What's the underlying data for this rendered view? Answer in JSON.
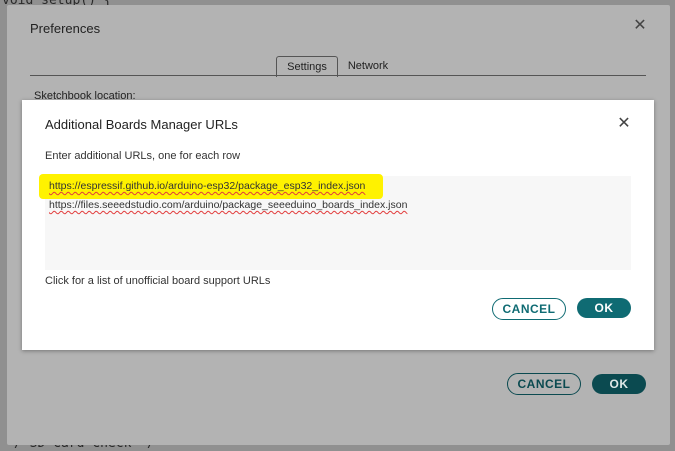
{
  "background_code": {
    "line_top": "void setup() {",
    "line_bottom": "/ SD Card Check */"
  },
  "preferences": {
    "title": "Preferences",
    "tabs": [
      {
        "label": "Settings",
        "active": true
      },
      {
        "label": "Network",
        "active": false
      }
    ],
    "sketchbook_label": "Sketchbook location:",
    "cancel_label": "CANCEL",
    "ok_label": "OK"
  },
  "boards_dialog": {
    "title": "Additional Boards Manager URLs",
    "instruction": "Enter additional URLs, one for each row",
    "urls": [
      "https://espressif.github.io/arduino-esp32/package_esp32_index.json",
      "https://files.seeedstudio.com/arduino/package_seeeduino_boards_index.json"
    ],
    "highlighted_url_index": 0,
    "unofficial_link": "Click for a list of unofficial board support URLs",
    "cancel_label": "CANCEL",
    "ok_label": "OK"
  },
  "colors": {
    "accent": "#0f6b73",
    "highlight": "#fff200",
    "spellcheck": "#e23b3b"
  },
  "icons": {
    "close": "close-icon"
  }
}
